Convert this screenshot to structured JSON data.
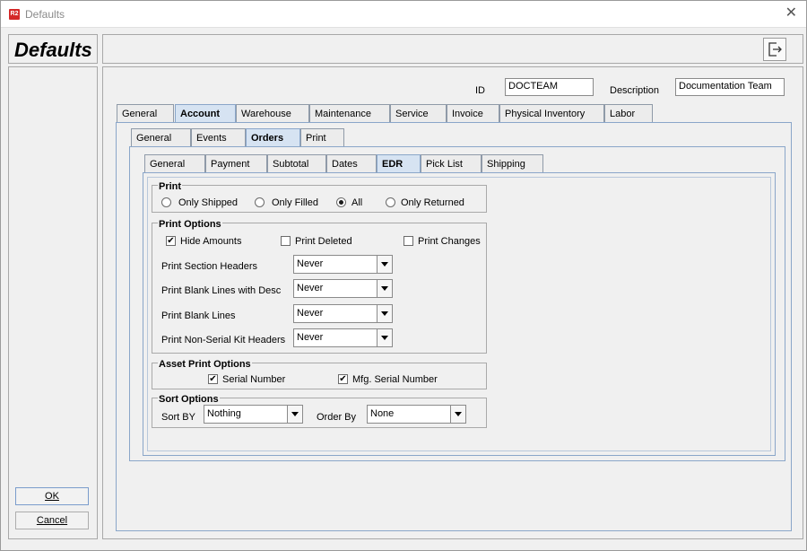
{
  "window": {
    "title": "Defaults",
    "app_icon": "R2"
  },
  "header": {
    "title": "Defaults"
  },
  "form": {
    "id_label": "ID",
    "id_value": "DOCTEAM",
    "description_label": "Description",
    "description_value": "Documentation Team"
  },
  "tabs_main": [
    "General",
    "Account",
    "Warehouse",
    "Maintenance",
    "Service",
    "Invoice",
    "Physical Inventory",
    "Labor"
  ],
  "tabs_account": [
    "General",
    "Events",
    "Orders",
    "Print"
  ],
  "tabs_orders": [
    "General",
    "Payment",
    "Subtotal",
    "Dates",
    "EDR",
    "Pick List",
    "Shipping"
  ],
  "print_group": {
    "title": "Print",
    "options": [
      "Only Shipped",
      "Only Filled",
      "All",
      "Only Returned"
    ],
    "selected": "All"
  },
  "print_options": {
    "title": "Print Options",
    "checks": [
      {
        "label": "Hide Amounts",
        "checked": true,
        "mark": "✔"
      },
      {
        "label": "Print Deleted",
        "checked": false,
        "mark": ""
      },
      {
        "label": "Print Changes",
        "checked": false,
        "mark": ""
      }
    ],
    "rows": [
      {
        "label": "Print Section Headers",
        "value": "Never"
      },
      {
        "label": "Print Blank Lines with Desc",
        "value": "Never"
      },
      {
        "label": "Print Blank Lines",
        "value": "Never"
      },
      {
        "label": "Print Non-Serial Kit Headers",
        "value": "Never"
      }
    ]
  },
  "asset_options": {
    "title": "Asset Print Options",
    "checks": [
      {
        "label": "Serial Number",
        "checked": true,
        "mark": "✔"
      },
      {
        "label": "Mfg. Serial Number",
        "checked": true,
        "mark": "✔"
      }
    ]
  },
  "sort_options": {
    "title": "Sort Options",
    "sort_by_label": "Sort BY",
    "sort_by_value": "Nothing",
    "order_by_label": "Order By",
    "order_by_value": "None"
  },
  "buttons": {
    "ok": "OK",
    "cancel": "Cancel"
  },
  "icons": {
    "close": "close-icon",
    "exit": "exit-icon",
    "dropdown": "chevron-down-icon"
  }
}
